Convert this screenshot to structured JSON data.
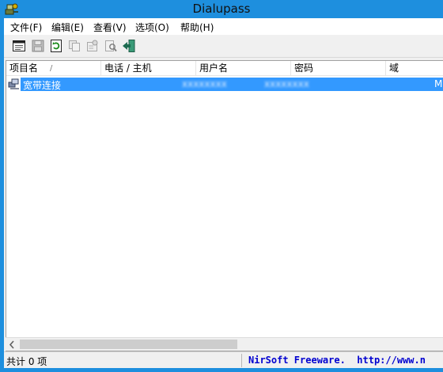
{
  "window": {
    "title": "Dialupass"
  },
  "menu": [
    "文件(F)",
    "编辑(E)",
    "查看(V)",
    "选项(O)",
    "帮助(H)"
  ],
  "toolbar_icons": [
    "html-report-icon",
    "save-icon",
    "refresh-icon",
    "copy-icon",
    "properties-icon",
    "find-icon",
    "exit-icon"
  ],
  "columns": [
    "项目名",
    "电话 / 主机",
    "用户名",
    "密码",
    "域"
  ],
  "sort_indicator": "/",
  "rows": [
    {
      "name": "宽带连接",
      "phone": "",
      "user": "xxxxxxxx",
      "password": "xxxxxxxx",
      "domain": "MS"
    }
  ],
  "status": {
    "count": "共计 0 项",
    "link": "NirSoft Freeware.  http://www.n"
  },
  "colors": {
    "titlebar": "#1e8fde",
    "selection": "#3399ff",
    "link": "#0000d0"
  }
}
